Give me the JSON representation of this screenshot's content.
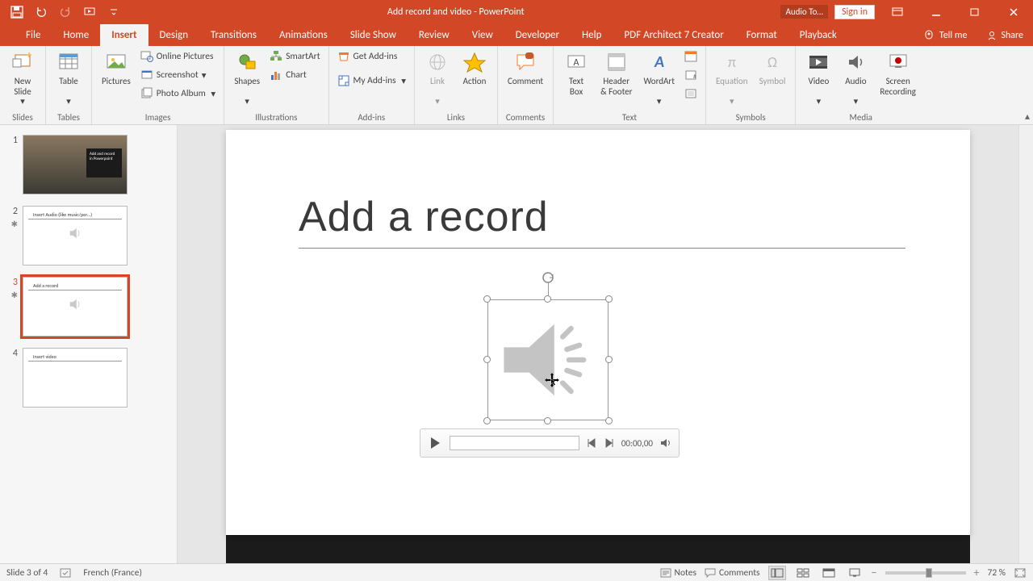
{
  "titlebar": {
    "document_title": "Add record and video  -  PowerPoint",
    "audio_tools": "Audio To…",
    "sign_in": "Sign in"
  },
  "tabs": {
    "items": [
      "File",
      "Home",
      "Insert",
      "Design",
      "Transitions",
      "Animations",
      "Slide Show",
      "Review",
      "View",
      "Developer",
      "Help",
      "PDF Architect 7 Creator",
      "Format",
      "Playback"
    ],
    "active_index": 2,
    "tell_me": "Tell me",
    "share": "Share"
  },
  "ribbon": {
    "slides": {
      "new_slide": "New\nSlide",
      "group": "Slides"
    },
    "tables": {
      "table": "Table",
      "group": "Tables"
    },
    "images": {
      "pictures": "Pictures",
      "online_pictures": "Online Pictures",
      "screenshot": "Screenshot",
      "photo_album": "Photo Album",
      "group": "Images"
    },
    "illustrations": {
      "shapes": "Shapes",
      "smartart": "SmartArt",
      "chart": "Chart",
      "group": "Illustrations"
    },
    "addins": {
      "get": "Get Add-ins",
      "my": "My Add-ins",
      "group": "Add-ins"
    },
    "links": {
      "link": "Link",
      "action": "Action",
      "group": "Links"
    },
    "comments": {
      "comment": "Comment",
      "group": "Comments"
    },
    "text": {
      "text_box": "Text\nBox",
      "header_footer": "Header\n& Footer",
      "wordart": "WordArt",
      "group": "Text"
    },
    "symbols": {
      "equation": "Equation",
      "symbol": "Symbol",
      "group": "Symbols"
    },
    "media": {
      "video": "Video",
      "audio": "Audio",
      "screen_recording": "Screen\nRecording",
      "group": "Media"
    }
  },
  "thumbnails": [
    {
      "num": "1",
      "title": "Add and record in Powerpoint",
      "has_star": false
    },
    {
      "num": "2",
      "title": "Insert Audio (like music/per...)",
      "has_star": true
    },
    {
      "num": "3",
      "title": "Add a record",
      "has_star": true,
      "selected": true
    },
    {
      "num": "4",
      "title": "Insert video",
      "has_star": false
    }
  ],
  "slide": {
    "title": "Add a record",
    "audio_time": "00:00,00"
  },
  "statusbar": {
    "slide_indicator": "Slide 3 of 4",
    "language": "French (France)",
    "notes": "Notes",
    "comments": "Comments",
    "zoom": "72 %"
  }
}
